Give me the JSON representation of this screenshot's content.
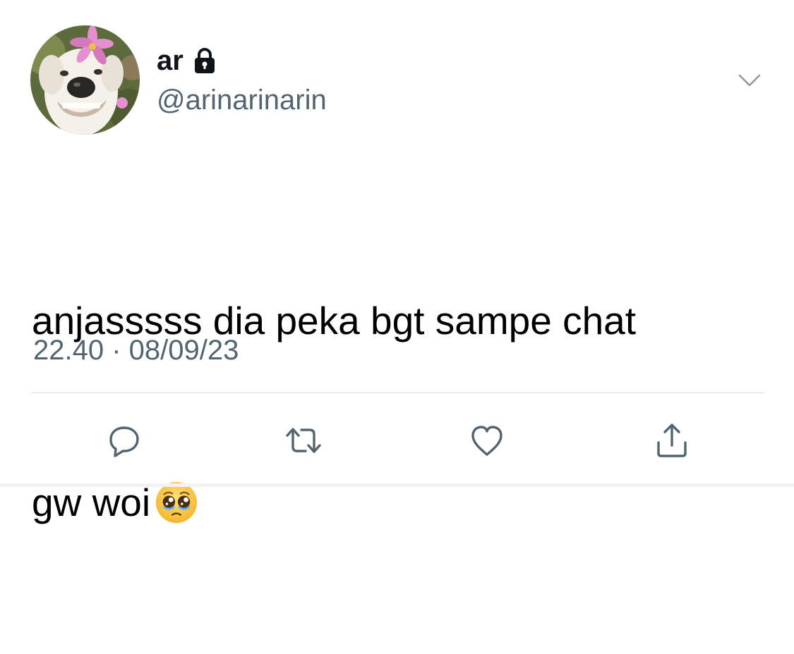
{
  "author": {
    "display_name": "ar",
    "handle": "@arinarinarin",
    "protected_icon": "lock-icon",
    "avatar": "dog-with-flower-avatar"
  },
  "tweet": {
    "lines": [
      "anjasssss dia peka bgt sampe chat",
      "gw woi"
    ],
    "emoji": "pleading-face-emoji",
    "timestamp": "22.40 · 08/09/23"
  },
  "actions": [
    {
      "name": "reply",
      "icon": "reply-icon"
    },
    {
      "name": "retweet",
      "icon": "retweet-icon"
    },
    {
      "name": "like",
      "icon": "heart-icon"
    },
    {
      "name": "share",
      "icon": "share-icon"
    }
  ],
  "colors": {
    "text_primary": "#0f1419",
    "text_secondary": "#536471",
    "icon": "#536471",
    "divider": "#d9d9d9"
  }
}
